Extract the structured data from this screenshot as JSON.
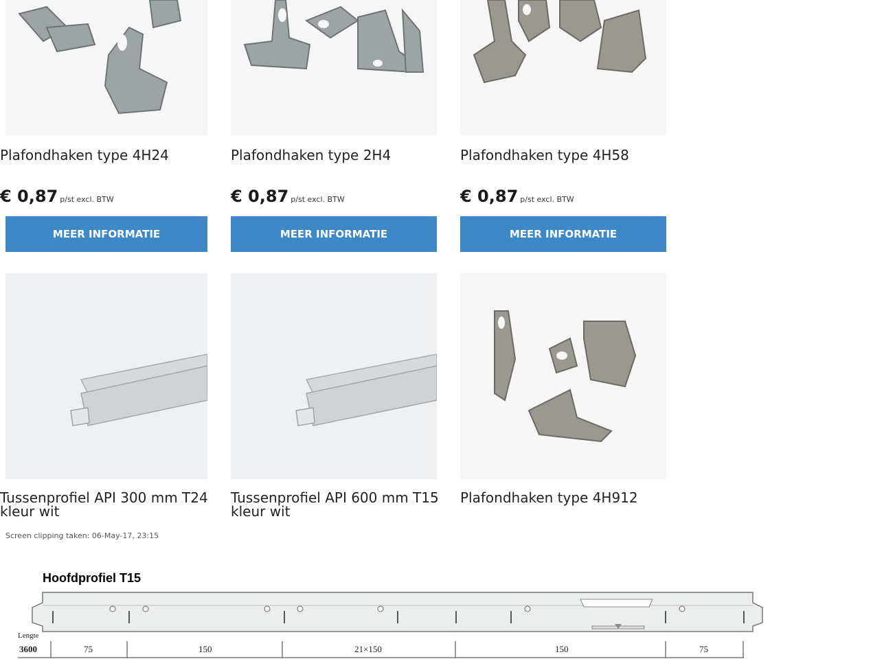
{
  "colors": {
    "button": "#3f88c8",
    "image_bg": "#f6f6f6"
  },
  "products_row1": [
    {
      "title": "Plafondhaken type 4H24",
      "price": "€ 0,87",
      "unit": "p/st excl. BTW",
      "button": "MEER INFORMATIE"
    },
    {
      "title": "Plafondhaken type 2H4",
      "price": "€ 0,87",
      "unit": "p/st excl. BTW",
      "button": "MEER INFORMATIE"
    },
    {
      "title": "Plafondhaken type 4H58",
      "price": "€ 0,87",
      "unit": "p/st excl. BTW",
      "button": "MEER INFORMATIE"
    }
  ],
  "products_row2": [
    {
      "title_line1": "Tussenprofiel API 300 mm T24",
      "title_line2": "kleur wit"
    },
    {
      "title_line1": "Tussenprofiel API 600 mm T15",
      "title_line2": "kleur wit"
    },
    {
      "title_line1": "Plafondhaken type 4H912",
      "title_line2": ""
    }
  ],
  "clip_note": "Screen clipping taken: 06-May-17, 23:15",
  "diagram": {
    "title": "Hoofdprofiel T15",
    "length_label": "Lengte",
    "length_value": "3600",
    "segments": [
      "75",
      "150",
      "21×150",
      "150",
      "75"
    ]
  }
}
